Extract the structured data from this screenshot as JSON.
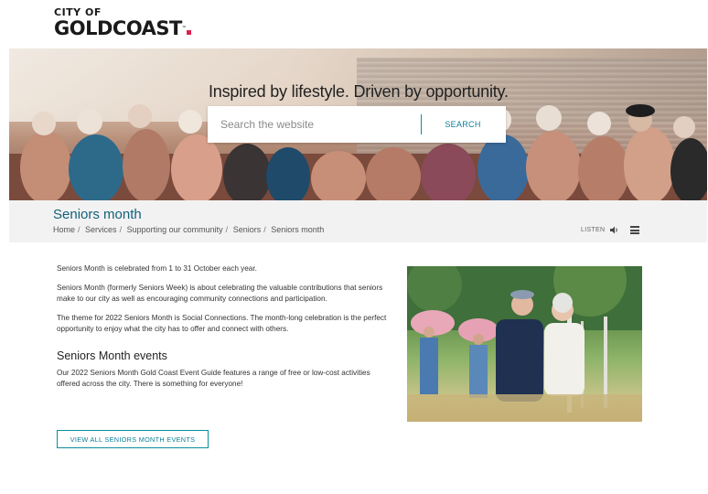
{
  "logo": {
    "line1": "CITY OF",
    "line2": "GOLDCOAST",
    "tm": "™"
  },
  "hero": {
    "headline": "Inspired by lifestyle. Driven by opportunity.",
    "search_placeholder": "Search the website",
    "search_button": "SEARCH"
  },
  "page": {
    "title": "Seniors month",
    "breadcrumb": [
      "Home",
      "Services",
      "Supporting our community",
      "Seniors",
      "Seniors month"
    ],
    "listen_label": "LISTEN"
  },
  "content": {
    "p1": "Seniors Month is celebrated from 1 to 31 October each year.",
    "p2": "Seniors Month (formerly Seniors Week) is about celebrating the valuable contributions that seniors make to our city as well as encouraging community connections and participation.",
    "p3": "The theme for 2022 Seniors Month is Social Connections. The month-long celebration is the perfect opportunity to enjoy what the city has to offer and connect with others.",
    "events_heading": "Seniors Month events",
    "p4": "Our 2022 Seniors Month Gold Coast Event Guide features a range of free or low-cost activities offered across the city. There is something for everyone!",
    "button": "VIEW ALL SENIORS MONTH EVENTS"
  },
  "icons": {
    "speaker": "speaker-icon",
    "menu": "menu-icon"
  },
  "colors": {
    "accent": "#0a8ea0",
    "title": "#14607a",
    "logo_dot": "#e0204f"
  }
}
